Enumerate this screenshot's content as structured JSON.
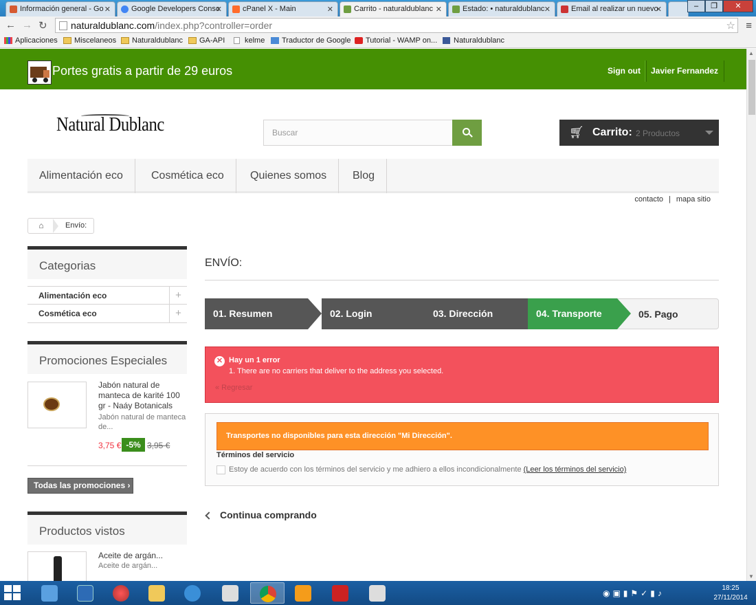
{
  "browser": {
    "tabs": [
      {
        "title": "Información general - Go",
        "fav": "#d65a31"
      },
      {
        "title": "Google Developers Consc",
        "fav": "#4285f4"
      },
      {
        "title": "cPanel X - Main",
        "fav": "#ff6c2c"
      },
      {
        "title": "Carrito - naturaldublanc",
        "fav": "#6f9e41"
      },
      {
        "title": "Estado: • naturaldublanc",
        "fav": "#6f9e41"
      },
      {
        "title": "Email al realizar un nuevo",
        "fav": "#c33"
      }
    ],
    "url_host": "naturaldublanc.com",
    "url_path": "/index.php?controller=order",
    "bookmarks": [
      "Aplicaciones",
      "Miscelaneos",
      "Naturaldublanc",
      "GA-API",
      "kelme",
      "Traductor de Google",
      "Tutorial - WAMP on...",
      "Naturaldublanc"
    ]
  },
  "banner": {
    "text": "Portes gratis a partir de 29 euros",
    "sign_out": "Sign out",
    "user": "Javier Fernandez"
  },
  "header": {
    "logo": "Natural Dublanc",
    "search_placeholder": "Buscar",
    "cart_label": "Carrito:",
    "cart_count": "2 Productos"
  },
  "menu": [
    "Alimentación eco",
    "Cosmética eco",
    "Quienes somos",
    "Blog"
  ],
  "toplinks": [
    "contacto",
    "|",
    "mapa sitio"
  ],
  "breadcrumb": "Envío:",
  "left": {
    "categories_title": "Categorias",
    "categories": [
      "Alimentación eco",
      "Cosmética eco"
    ],
    "promos_title": "Promociones Especiales",
    "promo_name": "Jabón natural de manteca de karité 100 gr - Naáy Botanicals",
    "promo_desc": "Jabón natural de manteca de...",
    "promo_price": "3,75 €",
    "promo_discount": "-5%",
    "promo_old_price": "3,95 €",
    "all_promos": "Todas las promociones",
    "viewed_title": "Productos vistos",
    "viewed_name": "Aceite de argán...",
    "viewed_desc": "Aceite de argán..."
  },
  "main": {
    "heading": "ENVÍO:",
    "steps": [
      "01. Resumen",
      "02. Login",
      "03. Dirección",
      "04. Transporte",
      "05. Pago"
    ],
    "current_step": 4,
    "error_title": "Hay un 1 error",
    "error_message": "1.  There are no carriers that deliver to the address you selected.",
    "error_back": "« Regresar",
    "carrier_warning": "Transportes no disponibles para esta dirección \"Mi Dirección\".",
    "tos_title": "Términos del servicio",
    "tos_text": "Estoy de acuerdo con los términos del servicio y me adhiero a ellos incondicionalmente",
    "tos_link": "(Leer los términos del servicio)",
    "continue": "Continua comprando"
  },
  "taskbar": {
    "time": "18:25",
    "date": "27/11/2014"
  },
  "colors": {
    "banner_green": "#459003",
    "step_current": "#3aa04c",
    "error_red": "#f3515c",
    "warning_orange": "#fe9126"
  }
}
